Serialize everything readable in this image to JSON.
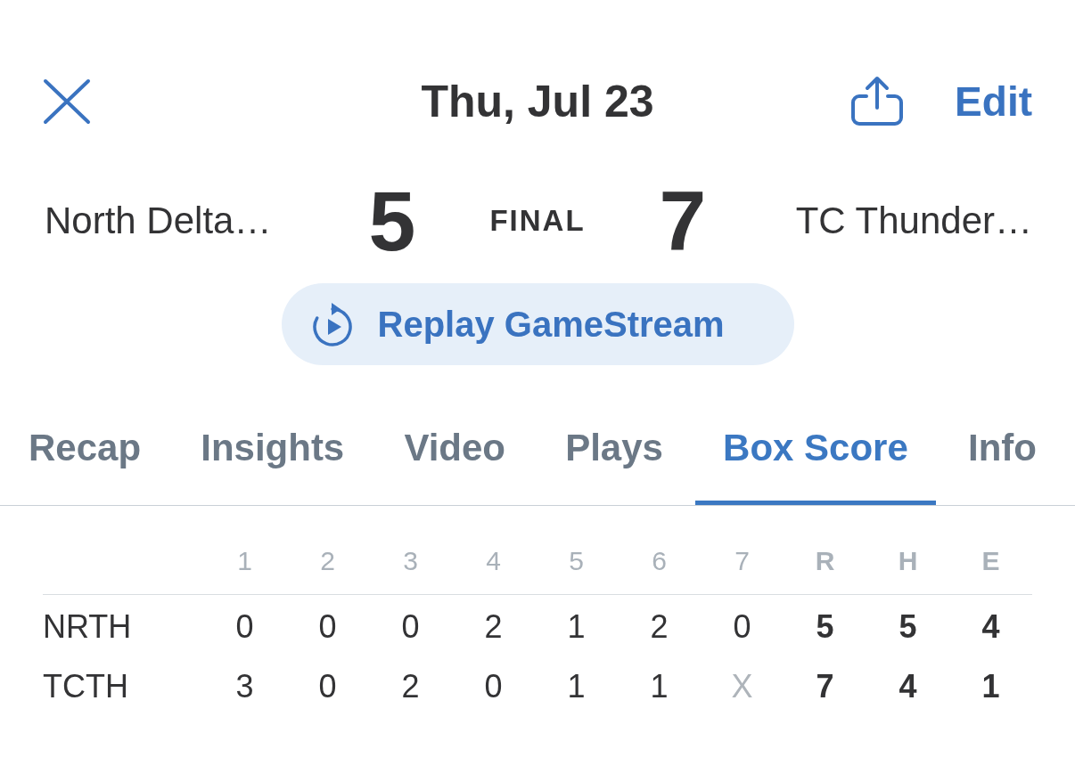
{
  "top_bar": {
    "title": "Thu, Jul 23",
    "edit_label": "Edit"
  },
  "score": {
    "away": {
      "name": "North Delta…",
      "runs": "5"
    },
    "status": "FINAL",
    "home": {
      "name": "TC Thunder…",
      "runs": "7"
    }
  },
  "replay_button": {
    "label": "Replay GameStream"
  },
  "tabs": [
    {
      "label": "Recap",
      "selected": false
    },
    {
      "label": "Insights",
      "selected": false
    },
    {
      "label": "Video",
      "selected": false
    },
    {
      "label": "Plays",
      "selected": false
    },
    {
      "label": "Box Score",
      "selected": true
    },
    {
      "label": "Info",
      "selected": false
    }
  ],
  "box_score": {
    "columns": [
      {
        "label": "1",
        "kind": "inning"
      },
      {
        "label": "2",
        "kind": "inning"
      },
      {
        "label": "3",
        "kind": "inning"
      },
      {
        "label": "4",
        "kind": "inning"
      },
      {
        "label": "5",
        "kind": "inning"
      },
      {
        "label": "6",
        "kind": "inning"
      },
      {
        "label": "7",
        "kind": "inning"
      },
      {
        "label": "R",
        "kind": "total"
      },
      {
        "label": "H",
        "kind": "total"
      },
      {
        "label": "E",
        "kind": "total"
      }
    ],
    "rows": [
      {
        "team": "NRTH",
        "cells": [
          {
            "value": "0",
            "kind": "inning"
          },
          {
            "value": "0",
            "kind": "inning"
          },
          {
            "value": "0",
            "kind": "inning"
          },
          {
            "value": "2",
            "kind": "inning"
          },
          {
            "value": "1",
            "kind": "inning"
          },
          {
            "value": "2",
            "kind": "inning"
          },
          {
            "value": "0",
            "kind": "inning"
          },
          {
            "value": "5",
            "kind": "total"
          },
          {
            "value": "5",
            "kind": "total"
          },
          {
            "value": "4",
            "kind": "total"
          }
        ]
      },
      {
        "team": "TCTH",
        "cells": [
          {
            "value": "3",
            "kind": "inning"
          },
          {
            "value": "0",
            "kind": "inning"
          },
          {
            "value": "2",
            "kind": "inning"
          },
          {
            "value": "0",
            "kind": "inning"
          },
          {
            "value": "1",
            "kind": "inning"
          },
          {
            "value": "1",
            "kind": "inning"
          },
          {
            "value": "X",
            "kind": "unplayed"
          },
          {
            "value": "7",
            "kind": "total"
          },
          {
            "value": "4",
            "kind": "total"
          },
          {
            "value": "1",
            "kind": "total"
          }
        ]
      }
    ]
  }
}
